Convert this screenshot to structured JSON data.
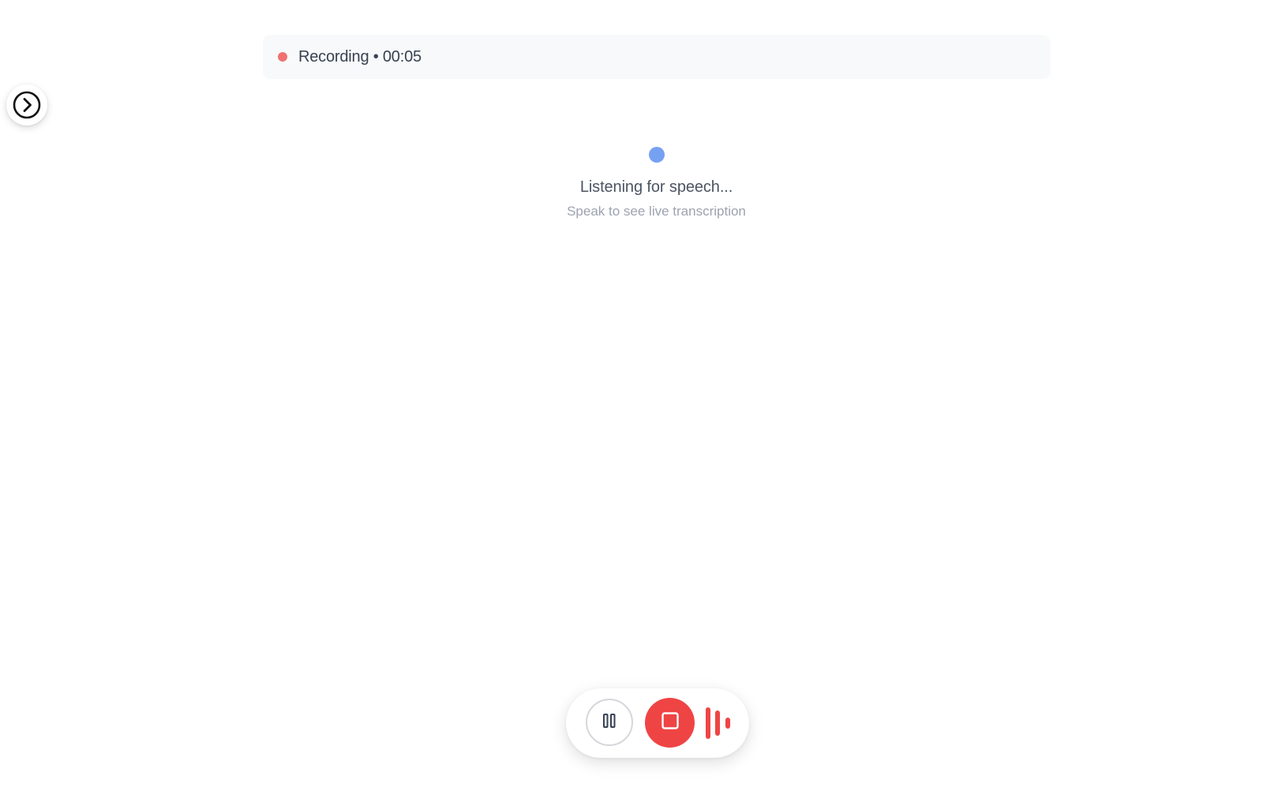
{
  "sidebar_toggle": {
    "icon": "chevron-right-circle-icon"
  },
  "status": {
    "text": "Recording • 00:05",
    "dot_color": "#ef7272"
  },
  "listening": {
    "title": "Listening for speech...",
    "subtitle": "Speak to see live transcription",
    "dot_color": "#76a1f3"
  },
  "controls": {
    "pause_icon": "pause-icon",
    "stop_icon": "stop-icon",
    "waveform_icon": "audio-waveform-icon",
    "accent_color": "#ef4444"
  }
}
